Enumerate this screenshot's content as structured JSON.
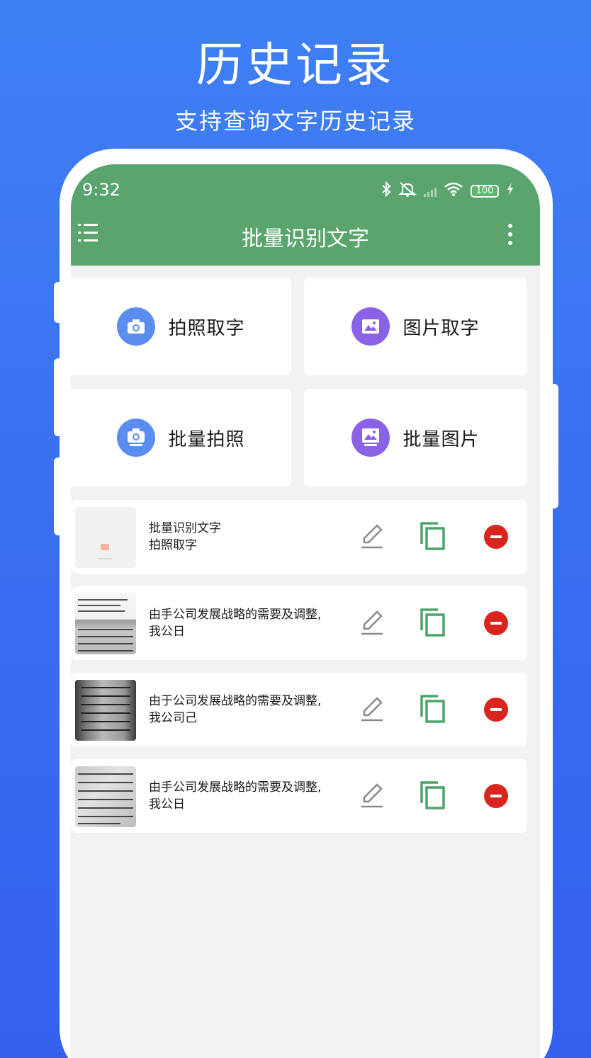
{
  "promo": {
    "title": "历史记录",
    "subtitle": "支持查询文字历史记录"
  },
  "status_bar": {
    "time": "9:32",
    "battery_percent": "100",
    "icons": [
      "bluetooth-icon",
      "mute-icon",
      "signal-icon",
      "wifi-icon",
      "battery-icon",
      "charging-icon"
    ]
  },
  "app_bar": {
    "title": "批量识别文字",
    "menu_icon": "hamburger-menu-icon",
    "more_icon": "more-vertical-icon",
    "color": "#5aa46e"
  },
  "features": [
    {
      "label": "拍照取字",
      "icon": "camera-icon",
      "color": "#5b8def"
    },
    {
      "label": "图片取字",
      "icon": "image-icon",
      "color": "#8a62e6"
    },
    {
      "label": "批量拍照",
      "icon": "batch-camera-icon",
      "color": "#5b8def"
    },
    {
      "label": "批量图片",
      "icon": "batch-image-icon",
      "color": "#8a62e6"
    }
  ],
  "history": [
    {
      "line1": "批量识别文字",
      "line2": "拍照取字"
    },
    {
      "line1": "由手公司发展战略的需要及调整,",
      "line2": "我公日"
    },
    {
      "line1": "由于公司发展战略的需要及调整,",
      "line2": "我公司己"
    },
    {
      "line1": "由手公司发展战略的需要及调整,",
      "line2": "我公日"
    }
  ],
  "colors": {
    "background": "#3a6ef0",
    "copy_icon": "#4ca46a",
    "delete_button": "#d9251d"
  }
}
